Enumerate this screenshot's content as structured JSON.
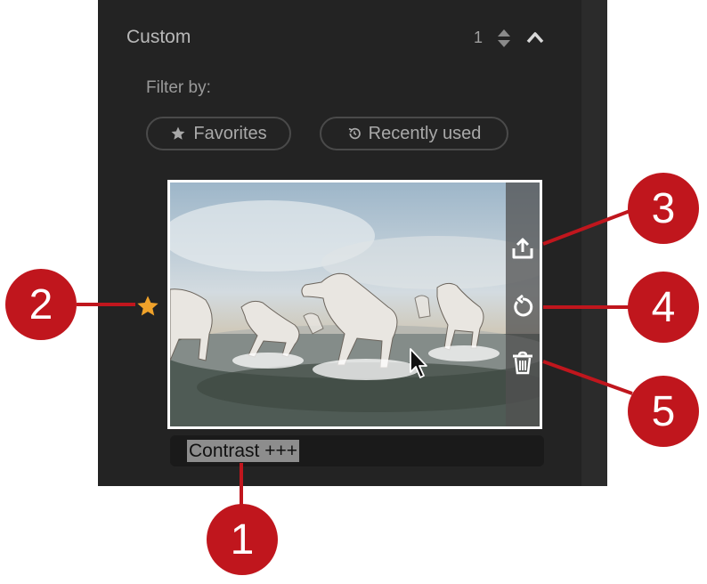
{
  "section": {
    "title": "Custom",
    "count": "1"
  },
  "filter": {
    "label": "Filter by:",
    "chips": [
      {
        "label": "Favorites",
        "icon": "star-icon"
      },
      {
        "label": "Recently used",
        "icon": "history-icon"
      }
    ]
  },
  "preset": {
    "name": "Contrast +++",
    "favorite": true,
    "thumbnail": "horses-running-through-water",
    "actions": [
      "export-icon",
      "reset-icon",
      "trash-icon"
    ]
  },
  "callouts": [
    "1",
    "2",
    "3",
    "4",
    "5"
  ],
  "colors": {
    "panel": "#232323",
    "callout": "#c0161d",
    "star": "#f0a22a"
  }
}
